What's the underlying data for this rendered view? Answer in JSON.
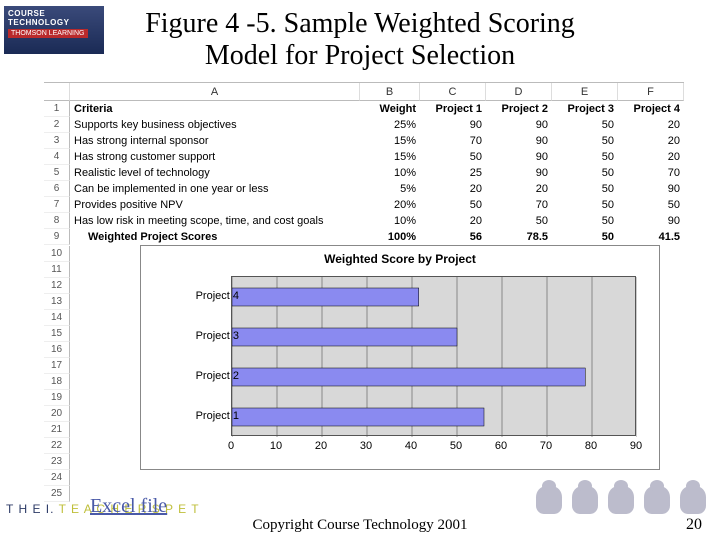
{
  "logo": {
    "line1": "COURSE",
    "line2": "TECHNOLOGY",
    "sub": "THOMSON LEARNING"
  },
  "title": "Figure 4 -5. Sample Weighted Scoring Model for Project Selection",
  "columnLetters": [
    "A",
    "B",
    "C",
    "D",
    "E",
    "F"
  ],
  "header": {
    "criteria": "Criteria",
    "weight": "Weight",
    "p1": "Project 1",
    "p2": "Project 2",
    "p3": "Project 3",
    "p4": "Project 4"
  },
  "rows": [
    {
      "n": 2,
      "label": "Supports key business objectives",
      "w": "25%",
      "v": [
        90,
        90,
        50,
        20
      ]
    },
    {
      "n": 3,
      "label": "Has strong internal sponsor",
      "w": "15%",
      "v": [
        70,
        90,
        50,
        20
      ]
    },
    {
      "n": 4,
      "label": "Has strong customer support",
      "w": "15%",
      "v": [
        50,
        90,
        50,
        20
      ]
    },
    {
      "n": 5,
      "label": "Realistic level of technology",
      "w": "10%",
      "v": [
        25,
        90,
        50,
        70
      ]
    },
    {
      "n": 6,
      "label": "Can be implemented in one year or less",
      "w": "5%",
      "v": [
        20,
        20,
        50,
        90
      ]
    },
    {
      "n": 7,
      "label": "Provides positive NPV",
      "w": "20%",
      "v": [
        50,
        70,
        50,
        50
      ]
    },
    {
      "n": 8,
      "label": "Has low risk in meeting scope, time, and cost goals",
      "w": "10%",
      "v": [
        20,
        50,
        50,
        90
      ]
    }
  ],
  "totals": {
    "label": "Weighted Project Scores",
    "w": "100%",
    "v": [
      56,
      78.5,
      50,
      41.5
    ]
  },
  "extraRowNums": [
    10,
    11,
    12,
    13,
    14,
    15,
    16,
    17,
    18,
    19,
    20,
    21,
    22,
    23,
    24,
    25
  ],
  "chart_data": {
    "type": "bar",
    "orientation": "horizontal",
    "title": "Weighted Score by Project",
    "categories": [
      "Project 1",
      "Project 2",
      "Project 3",
      "Project 4"
    ],
    "values": [
      56,
      78.5,
      50,
      41.5
    ],
    "xlim": [
      0,
      90
    ],
    "xticks": [
      0,
      10,
      20,
      30,
      40,
      50,
      60,
      70,
      80,
      90
    ],
    "xlabel": "",
    "ylabel": ""
  },
  "excelLink": "Excel file",
  "footerBrand": {
    "a": "T H E  I.",
    "b": "T E A C H E R S  P E T"
  },
  "copyright": "Copyright Course Technology 2001",
  "pageNum": "20"
}
